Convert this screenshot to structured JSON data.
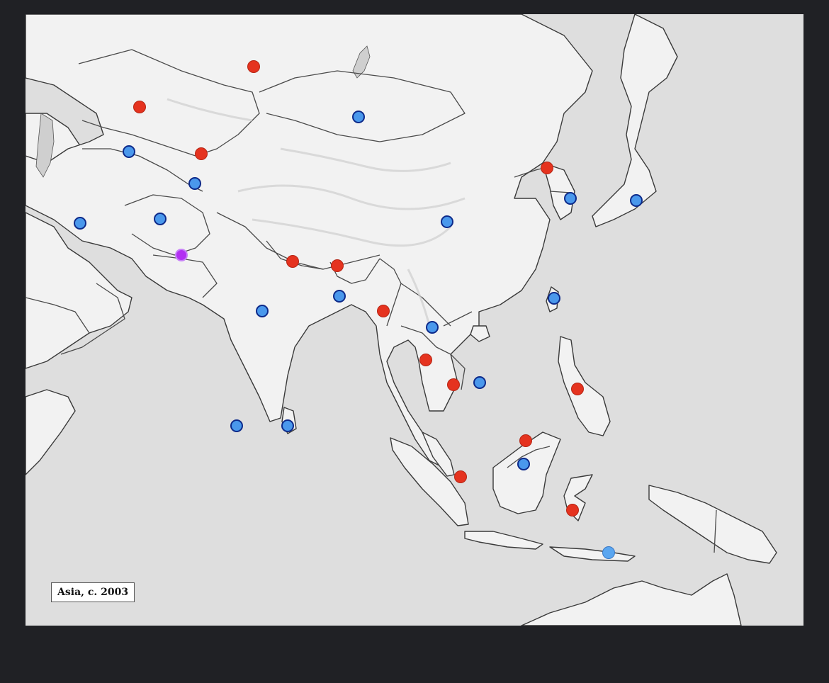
{
  "map": {
    "caption": "Asia, c. 2003",
    "marker_colors": {
      "red": "#e5331f",
      "blue": "#4a98ec",
      "blue_outline": "#0d2a8a",
      "purple": "#b230f2",
      "lightblue": "#5aa6f0"
    },
    "markers": [
      {
        "name": "marker-red-1",
        "color": "red"
      },
      {
        "name": "marker-red-2",
        "color": "red"
      },
      {
        "name": "marker-red-3",
        "color": "red"
      },
      {
        "name": "marker-red-4",
        "color": "red"
      },
      {
        "name": "marker-red-5",
        "color": "red"
      },
      {
        "name": "marker-red-6",
        "color": "red"
      },
      {
        "name": "marker-red-7",
        "color": "red"
      },
      {
        "name": "marker-red-8",
        "color": "red"
      },
      {
        "name": "marker-red-9",
        "color": "red"
      },
      {
        "name": "marker-red-10",
        "color": "red"
      },
      {
        "name": "marker-red-11",
        "color": "red"
      },
      {
        "name": "marker-red-12",
        "color": "red"
      },
      {
        "name": "marker-red-13",
        "color": "red"
      },
      {
        "name": "marker-red-14",
        "color": "red"
      },
      {
        "name": "marker-blue-1",
        "color": "blue"
      },
      {
        "name": "marker-blue-2",
        "color": "blue"
      },
      {
        "name": "marker-blue-3",
        "color": "blue"
      },
      {
        "name": "marker-blue-4",
        "color": "blue"
      },
      {
        "name": "marker-blue-5",
        "color": "blue"
      },
      {
        "name": "marker-blue-6",
        "color": "blue"
      },
      {
        "name": "marker-blue-7",
        "color": "blue"
      },
      {
        "name": "marker-blue-8",
        "color": "blue"
      },
      {
        "name": "marker-blue-9",
        "color": "blue"
      },
      {
        "name": "marker-blue-10",
        "color": "blue"
      },
      {
        "name": "marker-blue-11",
        "color": "blue"
      },
      {
        "name": "marker-blue-12",
        "color": "blue"
      },
      {
        "name": "marker-blue-13",
        "color": "blue"
      },
      {
        "name": "marker-blue-14",
        "color": "blue"
      },
      {
        "name": "marker-blue-15",
        "color": "blue"
      },
      {
        "name": "marker-blue-16",
        "color": "blue"
      },
      {
        "name": "marker-blue-17",
        "color": "blue"
      },
      {
        "name": "marker-purple-1",
        "color": "purple"
      },
      {
        "name": "marker-lightblue-1",
        "color": "lightblue"
      }
    ]
  }
}
